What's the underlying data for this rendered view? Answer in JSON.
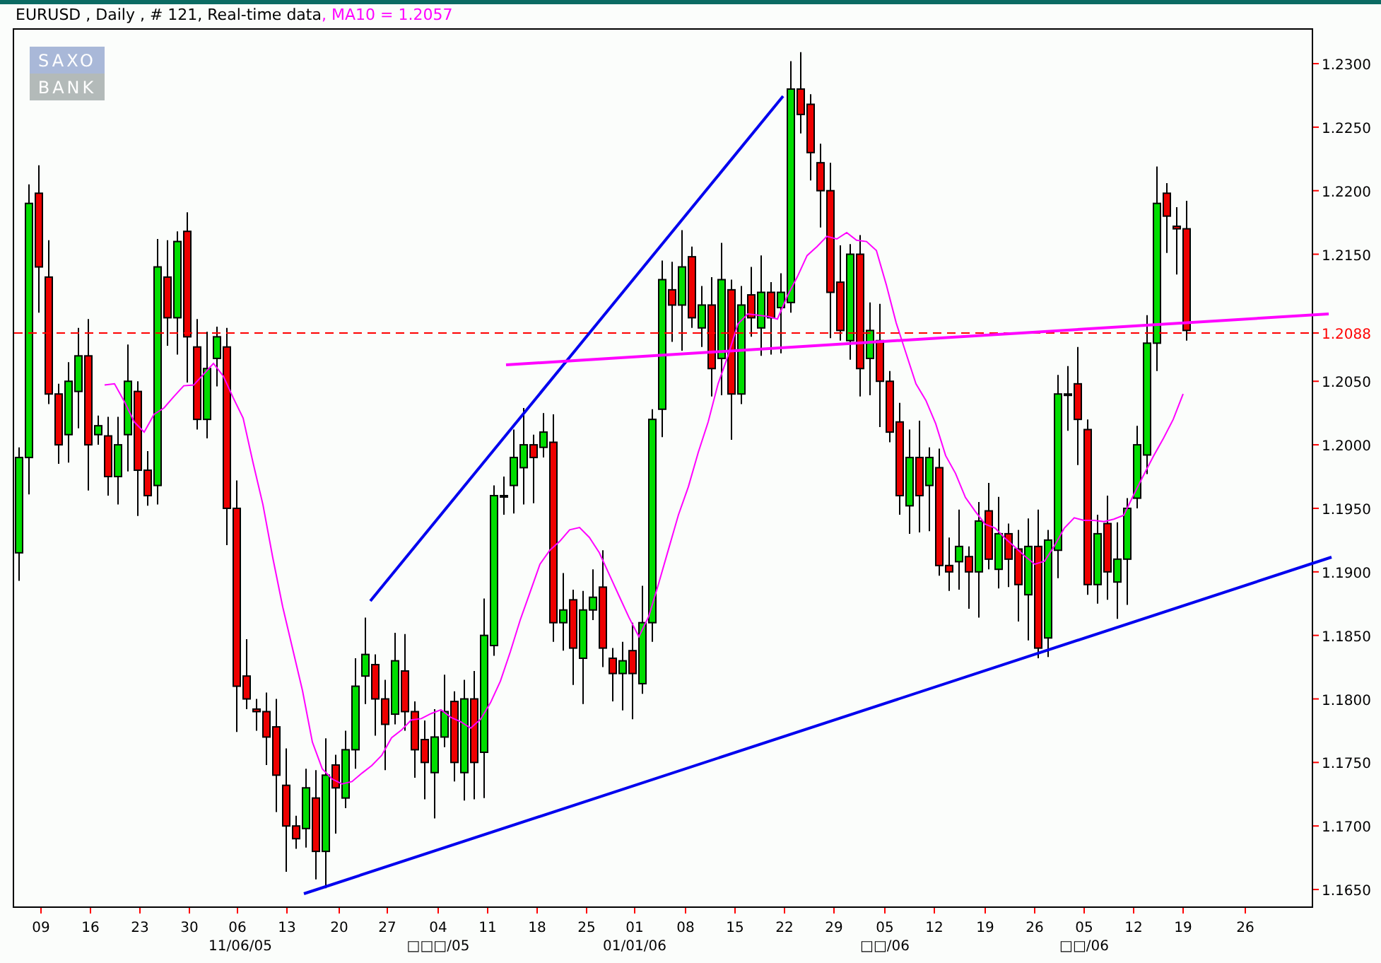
{
  "header": {
    "symbol_line": "EURUSD , Daily , # 121, Real-time data",
    "indicator": ", MA10 = 1.2057"
  },
  "logo": {
    "line_1": "SAXO",
    "line_2": "BANK"
  },
  "price_axis": {
    "ticks": [
      "1.2300",
      "1.2250",
      "1.2200",
      "1.2150",
      "1.2050",
      "1.2000",
      "1.1950",
      "1.1900",
      "1.1850",
      "1.1800",
      "1.1750",
      "1.1700",
      "1.1650"
    ],
    "current_price": "1.2088"
  },
  "date_axis": {
    "day_labels": [
      "09",
      "16",
      "23",
      "30",
      "06",
      "13",
      "20",
      "27",
      "04",
      "11",
      "18",
      "25",
      "01",
      "08",
      "15",
      "22",
      "29",
      "05",
      "12",
      "19",
      "26",
      "05",
      "12",
      "19",
      "26"
    ],
    "period_labels": [
      "11/06/05",
      "□□□/05",
      "01/01/06",
      "□□/06",
      "□□/06"
    ]
  }
}
